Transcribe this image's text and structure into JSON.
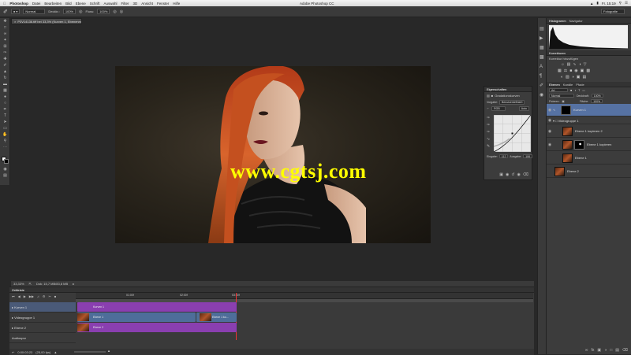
{
  "menubar": {
    "apple": "",
    "app_name": "Photoshop",
    "items": [
      "Datei",
      "Bearbeiten",
      "Bild",
      "Ebene",
      "Schrift",
      "Auswahl",
      "Filter",
      "3D",
      "Ansicht",
      "Fenster",
      "Hilfe"
    ],
    "clock": "Fr. 15:19"
  },
  "window_title": "Adobe Photoshop CC",
  "options": {
    "mode": "Normal",
    "opacity_label": "Deckkr.:",
    "opacity": "100%",
    "flow_label": "Fluss:",
    "flow": "100%",
    "workspace": "Fotografie"
  },
  "document": {
    "tab_title": "P3V14136.tiff bei 33,3% (Kurven 1, Ebenenmaske/8) *",
    "zoom": "33,33%",
    "doc_info": "Dok: 15,7 MB/83,8 MB",
    "watermark": "www.cgtsj.com"
  },
  "properties": {
    "title": "Eigenschaften",
    "subtitle": "Gradationskurven",
    "preset_label": "Vorgabe:",
    "preset": "Benutzerdefiniert",
    "channel": "RGB",
    "auto": "Auto",
    "input_label": "Eingabe:",
    "input": "112",
    "output_label": "Ausgabe:",
    "output": "106"
  },
  "panels": {
    "histogram_tabs": [
      "Histogramm",
      "Navigator"
    ],
    "adjustments_tab": "Korrekturen",
    "adjustments_title": "Korrektur hinzufügen",
    "layers_tabs": [
      "Ebenen",
      "Kanäle",
      "Pfade"
    ],
    "kind": "Art",
    "blend": "Normal",
    "opacity_label": "Deckkraft:",
    "opacity": "100%",
    "lock_label": "Fixieren:",
    "fill_label": "Fläche:",
    "fill": "100%",
    "layers": [
      {
        "name": "Kurven 1"
      },
      {
        "name": "Videogruppe 1"
      },
      {
        "name": "Ebene 1 kopieren 2"
      },
      {
        "name": "Ebene 1 kopieren"
      },
      {
        "name": "Ebene 1"
      },
      {
        "name": "Ebene 2"
      }
    ]
  },
  "timeline": {
    "title": "Zeitleiste",
    "ticks": [
      "01:00f",
      "02:00f",
      "03:00f"
    ],
    "tracks": [
      "Kurven 1",
      "Videogruppe 1",
      "Ebene 2",
      "Audiospur"
    ],
    "clips": [
      "Kurven 1",
      "Ebene 1",
      "Ebene 1 ko...",
      "Ebene 2"
    ],
    "timecode": "0:00:03:23",
    "fps": "(25,00 fps)"
  },
  "colors": {
    "clip_purple": "#8a3fb0",
    "clip_blue": "#4e6e9a",
    "layer_selected": "#5672a3",
    "watermark": "#ffff00"
  }
}
